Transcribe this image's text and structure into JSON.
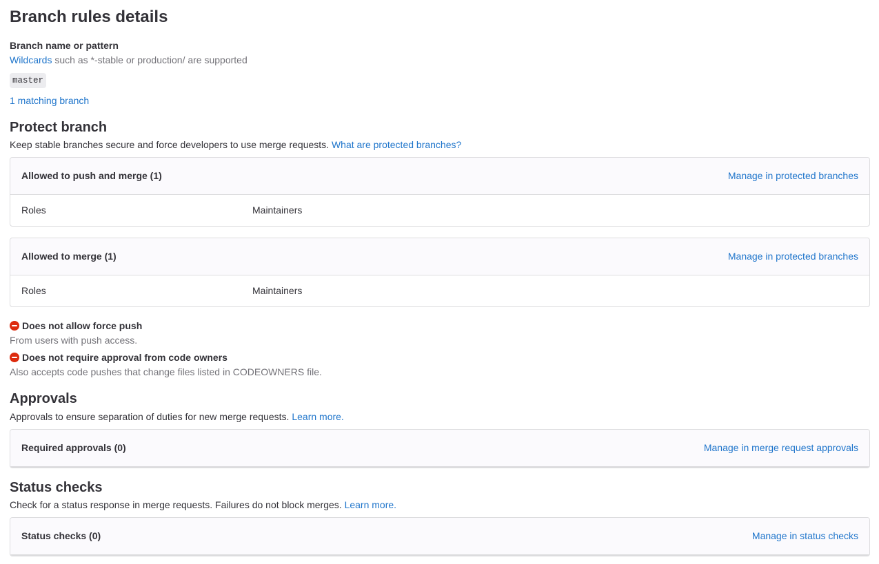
{
  "header": {
    "title": "Branch rules details"
  },
  "branch": {
    "label": "Branch name or pattern",
    "wildcards_link": "Wildcards",
    "wildcards_help": " such as *-stable or production/ are supported",
    "name": "master",
    "matching_link": "1 matching branch"
  },
  "protect": {
    "title": "Protect branch",
    "description": "Keep stable branches secure and force developers to use merge requests. ",
    "help_link": "What are protected branches?",
    "push_merge": {
      "title": "Allowed to push and merge (1)",
      "action": "Manage in protected branches",
      "row_label": "Roles",
      "row_value": "Maintainers"
    },
    "merge": {
      "title": "Allowed to merge (1)",
      "action": "Manage in protected branches",
      "row_label": "Roles",
      "row_value": "Maintainers"
    },
    "force_push": {
      "title": "Does not allow force push",
      "help": "From users with push access."
    },
    "code_owners": {
      "title": "Does not require approval from code owners",
      "help": "Also accepts code pushes that change files listed in CODEOWNERS file."
    }
  },
  "approvals": {
    "title": "Approvals",
    "description": "Approvals to ensure separation of duties for new merge requests. ",
    "learn_more": "Learn more.",
    "card_title": "Required approvals (0)",
    "card_action": "Manage in merge request approvals"
  },
  "status_checks": {
    "title": "Status checks",
    "description": "Check for a status response in merge requests. Failures do not block merges. ",
    "learn_more": "Learn more.",
    "card_title": "Status checks (0)",
    "card_action": "Manage in status checks"
  },
  "colors": {
    "link": "#1f75cb",
    "deny_icon": "#dd2b0e",
    "card_header_bg": "#fbfafd",
    "border": "#dcdcde"
  },
  "icons": {
    "deny": "deny-icon"
  }
}
